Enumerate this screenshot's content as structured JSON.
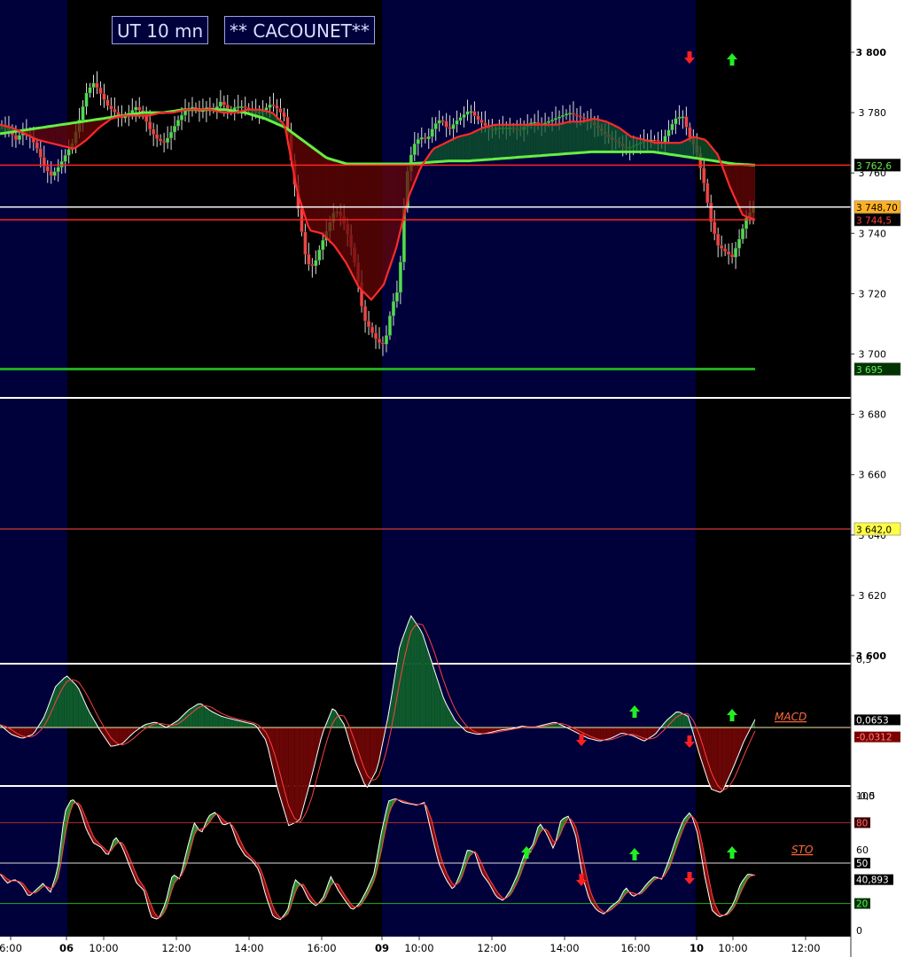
{
  "title": {
    "timeframe": "UT 10 mn",
    "name": "** CACOUNET**"
  },
  "colors": {
    "session_night": "#00003a",
    "session_day": "#000000",
    "bull_candle": "#56d856",
    "bear_candle": "#e84848",
    "fast_ma": "#ff2a2a",
    "slow_ma": "#66ee44",
    "fill_bull": "#0f5a2c",
    "fill_bear": "#6a0606",
    "axis_bg": "#ffffff"
  },
  "chart_data": [
    {
      "type": "candlestick",
      "panel": "price",
      "y_axis_ticks": [
        "3 800",
        "3 780",
        "3 760",
        "3 740",
        "3 720",
        "3 700",
        "3 680",
        "3 660",
        "3 640",
        "3 620",
        "3 600"
      ],
      "ylim": [
        3600,
        3800
      ],
      "x_tick_labels": [
        {
          "label": "6:00",
          "bold": false
        },
        {
          "label": "06",
          "bold": true
        },
        {
          "label": "10:00",
          "bold": false
        },
        {
          "label": "12:00",
          "bold": false
        },
        {
          "label": "14:00",
          "bold": false
        },
        {
          "label": "16:00",
          "bold": false
        },
        {
          "label": "09",
          "bold": true
        },
        {
          "label": "10:00",
          "bold": false
        },
        {
          "label": "12:00",
          "bold": false
        },
        {
          "label": "14:00",
          "bold": false
        },
        {
          "label": "16:00",
          "bold": false
        },
        {
          "label": "10",
          "bold": true
        },
        {
          "label": "10:00",
          "bold": false
        },
        {
          "label": "12:00",
          "bold": false
        }
      ],
      "close_path": [
        3776,
        3774,
        3771,
        3774,
        3772,
        3768,
        3762,
        3759,
        3762,
        3766,
        3770,
        3778,
        3787,
        3790,
        3786,
        3782,
        3780,
        3778,
        3780,
        3782,
        3779,
        3774,
        3771,
        3770,
        3774,
        3778,
        3781,
        3782,
        3780,
        3782,
        3781,
        3784,
        3780,
        3782,
        3782,
        3781,
        3780,
        3781,
        3783,
        3781,
        3778,
        3761,
        3745,
        3730,
        3729,
        3736,
        3742,
        3748,
        3745,
        3738,
        3728,
        3712,
        3708,
        3704,
        3703,
        3716,
        3722,
        3758,
        3769,
        3772,
        3771,
        3776,
        3778,
        3774,
        3777,
        3779,
        3781,
        3778,
        3776,
        3774,
        3775,
        3775,
        3775,
        3774,
        3776,
        3777,
        3776,
        3777,
        3778,
        3779,
        3780,
        3779,
        3778,
        3777,
        3775,
        3773,
        3771,
        3770,
        3768,
        3769,
        3770,
        3771,
        3771,
        3770,
        3774,
        3778,
        3779,
        3772,
        3767,
        3757,
        3744,
        3736,
        3734,
        3732,
        3738,
        3745,
        3748.7
      ],
      "fast_ma_path": [
        3776,
        3775,
        3773,
        3771,
        3770,
        3769,
        3768,
        3771,
        3775,
        3778,
        3779,
        3779,
        3779,
        3780,
        3780,
        3781,
        3781,
        3781,
        3780,
        3780,
        3781,
        3781,
        3780,
        3776,
        3754,
        3741,
        3740,
        3736,
        3730,
        3722,
        3718,
        3723,
        3735,
        3752,
        3762,
        3768,
        3770,
        3772,
        3773,
        3775,
        3776,
        3776,
        3776,
        3776,
        3776,
        3776,
        3777,
        3777,
        3778,
        3777,
        3775,
        3772,
        3771,
        3770,
        3770,
        3770,
        3772,
        3771,
        3766,
        3755,
        3746,
        3744.5
      ],
      "slow_ma_path": [
        3773,
        3774,
        3775,
        3776,
        3777,
        3778,
        3779,
        3780,
        3780,
        3781,
        3781,
        3781,
        3780,
        3778,
        3775,
        3770,
        3765,
        3763,
        3763,
        3763,
        3763,
        3763.5,
        3764,
        3764,
        3764.5,
        3765,
        3765.5,
        3766,
        3766.5,
        3767,
        3767,
        3767,
        3767,
        3766,
        3765,
        3764,
        3763,
        3762.6
      ],
      "levels": [
        {
          "label": "3 762,6",
          "value": 3762.6,
          "color": "#ff2222",
          "tag_bg": "#000000",
          "tag_fg": "#66ee44"
        },
        {
          "label": "3 748,70",
          "value": 3748.7,
          "color": "#ffffff",
          "tag_bg": "#ffb020",
          "tag_fg": "#000000"
        },
        {
          "label": "3 744,5",
          "value": 3744.5,
          "color": "#ff2222",
          "tag_bg": "#000000",
          "tag_fg": "#ff4040"
        },
        {
          "label": "3 695",
          "value": 3695,
          "color": "#22aa22",
          "tag_bg": "#003300",
          "tag_fg": "#66ee66"
        },
        {
          "label": "3 642,0",
          "value": 3642,
          "color": "#b03030",
          "tag_bg": "#ffff44",
          "tag_fg": "#000000"
        }
      ],
      "signals": [
        {
          "direction": "down",
          "color": "#ff2020"
        },
        {
          "direction": "up",
          "color": "#22ee22"
        }
      ]
    },
    {
      "type": "line",
      "panel": "macd",
      "label": "MACD",
      "y_axis_ticks": [
        "0,5",
        "-0,5"
      ],
      "ylim": [
        -1.0,
        1.0
      ],
      "value_tags": [
        "0,0653",
        "-0,0312"
      ],
      "macd_path": [
        0.02,
        -0.05,
        -0.08,
        -0.05,
        0.08,
        0.3,
        0.38,
        0.3,
        0.12,
        -0.02,
        -0.14,
        -0.12,
        -0.04,
        0.02,
        0.04,
        0.0,
        0.05,
        0.13,
        0.18,
        0.12,
        0.08,
        0.06,
        0.04,
        0.02,
        -0.1,
        -0.45,
        -0.72,
        -0.68,
        -0.38,
        -0.05,
        0.15,
        0.02,
        -0.25,
        -0.45,
        -0.3,
        0.1,
        0.6,
        0.82,
        0.7,
        0.45,
        0.2,
        0.05,
        -0.03,
        -0.05,
        -0.04,
        -0.02,
        -0.01,
        0.01,
        0.0,
        0.02,
        0.04,
        0.0,
        -0.04,
        -0.08,
        -0.1,
        -0.08,
        -0.04,
        -0.06,
        -0.1,
        -0.05,
        0.05,
        0.12,
        0.08,
        -0.2,
        -0.45,
        -0.48,
        -0.3,
        -0.1,
        0.06
      ]
    },
    {
      "type": "line",
      "panel": "stochastic",
      "label": "STO",
      "y_axis_ticks": [
        "100",
        "80",
        "60",
        "50",
        "40,893",
        "20",
        "0"
      ],
      "ylim": [
        0,
        100
      ],
      "value_tags": [
        "80",
        "50",
        "40,893",
        "20"
      ],
      "sto_path": [
        42,
        35,
        38,
        34,
        25,
        30,
        35,
        28,
        45,
        88,
        98,
        92,
        75,
        65,
        62,
        55,
        70,
        62,
        48,
        35,
        30,
        10,
        8,
        20,
        42,
        38,
        60,
        80,
        72,
        85,
        88,
        78,
        80,
        65,
        56,
        52,
        45,
        25,
        10,
        8,
        15,
        38,
        33,
        22,
        18,
        25,
        40,
        30,
        22,
        15,
        20,
        30,
        42,
        72,
        96,
        98,
        95,
        94,
        93,
        95,
        72,
        50,
        38,
        30,
        42,
        60,
        58,
        42,
        35,
        25,
        22,
        30,
        42,
        58,
        62,
        80,
        72,
        60,
        82,
        85,
        72,
        40,
        22,
        15,
        12,
        18,
        22,
        32,
        25,
        28,
        35,
        40,
        38,
        52,
        68,
        82,
        88,
        72,
        40,
        15,
        10,
        12,
        20,
        35,
        42,
        40.9
      ]
    }
  ]
}
